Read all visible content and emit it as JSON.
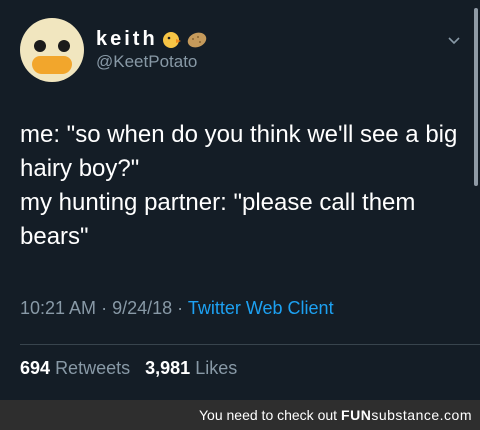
{
  "user": {
    "display_name": "keith",
    "handle": "@KeetPotato",
    "avatar_icon": "duck-face-avatar",
    "name_emojis": [
      "baby-chick-emoji",
      "potato-emoji"
    ]
  },
  "tweet": {
    "lines": [
      "me: \"so when do you think we'll see a big hairy boy?\"",
      "my hunting partner: \"please call them bears\""
    ],
    "time": "10:21 AM",
    "date": "9/24/18",
    "client": "Twitter Web Client",
    "separator": "·"
  },
  "stats": {
    "retweets_count": "694",
    "retweets_label": "Retweets",
    "likes_count": "3,981",
    "likes_label": "Likes"
  },
  "footer": {
    "prefix": "You need to check out",
    "brand": "FUN",
    "brand_rest": "substance.com"
  },
  "colors": {
    "background": "#141d26",
    "secondary_text": "#8899a6",
    "link": "#1da1f2",
    "footer_bg": "#2e2e2e"
  }
}
